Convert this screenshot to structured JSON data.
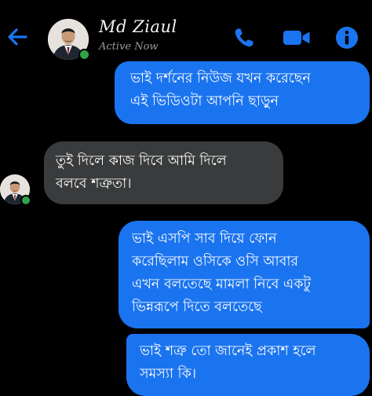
{
  "header": {
    "back_icon": "arrow-left-icon",
    "contact_name": "Md Ziaul",
    "contact_status": "Active Now",
    "call_icon": "phone-icon",
    "video_icon": "video-camera-icon",
    "info_icon": "info-icon"
  },
  "colors": {
    "accent": "#1b74ef",
    "incoming_bubble": "#3a3b3c",
    "background": "#000000",
    "online": "#31a24c"
  },
  "messages": [
    {
      "direction": "outgoing",
      "lines": [
        "ভাই দর্শনের নিউজ যখন করেছেন",
        "এই ভিডিওটা আপনি ছাড়ুন"
      ]
    },
    {
      "direction": "incoming",
      "lines": [
        "তুই দিলে কাজ দিবে আমি দিলে",
        "বলবে শত্রুতা।"
      ]
    },
    {
      "direction": "outgoing",
      "lines": [
        "ভাই এসপি সাব দিয়ে ফোন",
        "করেছিলাম ওসিকে ওসি আবার",
        "এখন বলতেছে মামলা নিবে একটু",
        "ভিন্নরূপে দিতে বলতেছে"
      ]
    },
    {
      "direction": "outgoing",
      "lines": [
        "ভাই শত্রু তো জানেই প্রকাশ হলে",
        "সমস্যা কি।"
      ]
    }
  ]
}
